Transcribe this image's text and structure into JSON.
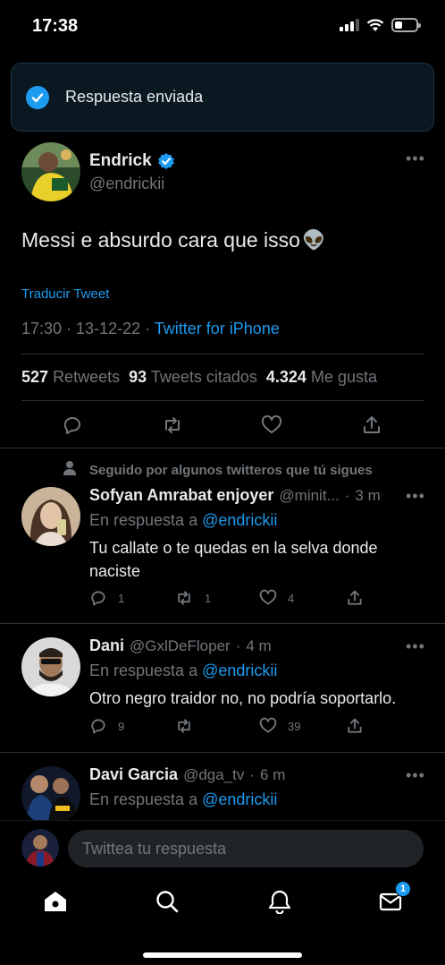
{
  "status_bar": {
    "time": "17:38"
  },
  "toast": {
    "text": "Respuesta enviada"
  },
  "main_tweet": {
    "author_name": "Endrick",
    "author_handle": "@endrickii",
    "text": "Messi e absurdo cara que isso",
    "emoji": "👽",
    "translate_label": "Traducir Tweet",
    "time": "17:30",
    "date": "13-12-22",
    "source": "Twitter for iPhone",
    "retweets_count": "527",
    "retweets_label": "Retweets",
    "quotes_count": "93",
    "quotes_label": "Tweets citados",
    "likes_count": "4.324",
    "likes_label": "Me gusta"
  },
  "replies": [
    {
      "social_context": "Seguido por algunos twitteros que tú sigues",
      "name": "Sofyan Amrabat enjoyer",
      "handle": "@minit...",
      "time": "3 m",
      "reply_prefix": "En respuesta a",
      "reply_to": "@endrickii",
      "text": "Tu callate o te quedas en la selva donde naciste",
      "reply_count": "1",
      "retweet_count": "1",
      "like_count": "4"
    },
    {
      "name": "Dani",
      "handle": "@GxlDeFloper",
      "time": "4 m",
      "reply_prefix": "En respuesta a",
      "reply_to": "@endrickii",
      "text": "Otro negro traidor no, no podría soportarlo.",
      "reply_count": "9",
      "retweet_count": "",
      "like_count": "39"
    },
    {
      "name": "Davi Garcia",
      "handle": "@dga_tv",
      "time": "6 m",
      "reply_prefix": "En respuesta a",
      "reply_to": "@endrickii"
    }
  ],
  "composer": {
    "placeholder": "Twittea tu respuesta"
  },
  "nav": {
    "messages_badge": "1"
  },
  "colors": {
    "accent": "#1d9bf0",
    "background": "#000000",
    "muted": "#71767b"
  }
}
